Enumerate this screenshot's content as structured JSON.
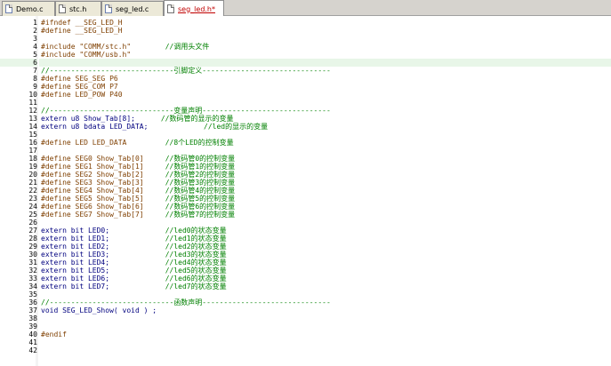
{
  "tabs": [
    {
      "label": "Demo.c",
      "type": "c"
    },
    {
      "label": "stc.h",
      "type": "h"
    },
    {
      "label": "seg_led.c",
      "type": "c"
    },
    {
      "label": "seg_led.h*",
      "type": "h",
      "active": true
    }
  ],
  "editor": {
    "lines": [
      {
        "n": "1",
        "code": "#ifndef __SEG_LED_H",
        "comment": ""
      },
      {
        "n": "2",
        "code": "#define __SEG_LED_H",
        "comment": ""
      },
      {
        "n": "3",
        "code": "",
        "comment": ""
      },
      {
        "n": "4",
        "code": "#include \"COMM/stc.h\"        ",
        "comment": "//调用头文件"
      },
      {
        "n": "5",
        "code": "#include \"COMM/usb.h\"",
        "comment": ""
      },
      {
        "n": "6",
        "code": "",
        "comment": ""
      },
      {
        "n": "7",
        "code": "",
        "comment": "//-----------------------------引脚定义------------------------------"
      },
      {
        "n": "8",
        "code": "#define SEG_SEG P6",
        "comment": ""
      },
      {
        "n": "9",
        "code": "#define SEG_COM P7",
        "comment": ""
      },
      {
        "n": "10",
        "code": "#define LED_POW P40",
        "comment": ""
      },
      {
        "n": "11",
        "code": "",
        "comment": ""
      },
      {
        "n": "12",
        "code": "",
        "comment": "//-----------------------------变量声明------------------------------"
      },
      {
        "n": "13",
        "code": "extern u8 Show_Tab[8];      ",
        "comment": "//数码管的显示的变量"
      },
      {
        "n": "14",
        "code": "extern u8 bdata LED_DATA;             ",
        "comment": "//led的显示的变量"
      },
      {
        "n": "15",
        "code": "",
        "comment": ""
      },
      {
        "n": "16",
        "code": "#define LED LED_DATA         ",
        "comment": "//8个LED的控制变量"
      },
      {
        "n": "17",
        "code": "",
        "comment": ""
      },
      {
        "n": "18",
        "code": "#define SEG0 Show_Tab[0]     ",
        "comment": "//数码管0的控制变量"
      },
      {
        "n": "19",
        "code": "#define SEG1 Show_Tab[1]     ",
        "comment": "//数码管1的控制变量"
      },
      {
        "n": "20",
        "code": "#define SEG2 Show_Tab[2]     ",
        "comment": "//数码管2的控制变量"
      },
      {
        "n": "21",
        "code": "#define SEG3 Show_Tab[3]     ",
        "comment": "//数码管3的控制变量"
      },
      {
        "n": "22",
        "code": "#define SEG4 Show_Tab[4]     ",
        "comment": "//数码管4的控制变量"
      },
      {
        "n": "23",
        "code": "#define SEG5 Show_Tab[5]     ",
        "comment": "//数码管5的控制变量"
      },
      {
        "n": "24",
        "code": "#define SEG6 Show_Tab[6]     ",
        "comment": "//数码管6的控制变量"
      },
      {
        "n": "25",
        "code": "#define SEG7 Show_Tab[7]     ",
        "comment": "//数码管7的控制变量"
      },
      {
        "n": "26",
        "code": "",
        "comment": ""
      },
      {
        "n": "27",
        "code": "extern bit LED0;             ",
        "comment": "//led0的状态变量"
      },
      {
        "n": "28",
        "code": "extern bit LED1;             ",
        "comment": "//led1的状态变量"
      },
      {
        "n": "29",
        "code": "extern bit LED2;             ",
        "comment": "//led2的状态变量"
      },
      {
        "n": "30",
        "code": "extern bit LED3;             ",
        "comment": "//led3的状态变量"
      },
      {
        "n": "31",
        "code": "extern bit LED4;             ",
        "comment": "//led4的状态变量"
      },
      {
        "n": "32",
        "code": "extern bit LED5;             ",
        "comment": "//led5的状态变量"
      },
      {
        "n": "33",
        "code": "extern bit LED6;             ",
        "comment": "//led6的状态变量"
      },
      {
        "n": "34",
        "code": "extern bit LED7;             ",
        "comment": "//led7的状态变量"
      },
      {
        "n": "35",
        "code": "",
        "comment": ""
      },
      {
        "n": "36",
        "code": "",
        "comment": "//-----------------------------函数声明------------------------------"
      },
      {
        "n": "37",
        "code": "void SEG_LED_Show( void ) ;",
        "comment": ""
      },
      {
        "n": "38",
        "code": "",
        "comment": ""
      },
      {
        "n": "39",
        "code": "",
        "comment": ""
      },
      {
        "n": "40",
        "code": "#endif",
        "comment": ""
      },
      {
        "n": "41",
        "code": "",
        "comment": ""
      },
      {
        "n": "42",
        "code": "",
        "comment": ""
      }
    ],
    "highlight_line": 6
  },
  "colors": {
    "comment": "#008000",
    "keyword": "#00007f",
    "preprocessor": "#7f3f00",
    "active_line": "#e8f6e8",
    "active_tab_text": "#c00000"
  }
}
